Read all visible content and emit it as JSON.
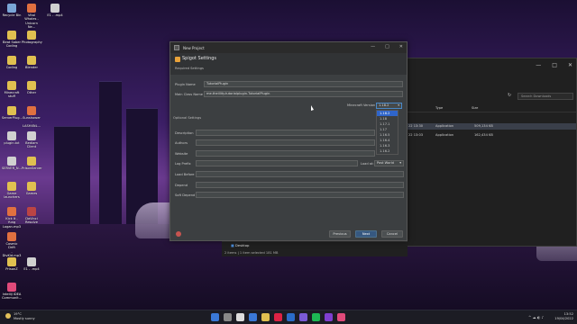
{
  "desktop": {
    "icons": [
      {
        "label": "Recycle Bin",
        "color": "#7aa6d6"
      },
      {
        "label": "Vital Whales -\nUnicorn Ne...",
        "color": "#e07040"
      },
      {
        "label": "E1 - .mp4",
        "color": "#d0d0d0"
      },
      {
        "label": "Beat Saber\nCoding",
        "color": "#e0c050"
      },
      {
        "label": "Photography",
        "color": "#e0c050"
      },
      {
        "label": "Coding",
        "color": "#e0c050"
      },
      {
        "label": "Blender",
        "color": "#e0c050"
      },
      {
        "label": "Minecraft\nstuff",
        "color": "#e0c050"
      },
      {
        "label": "Other",
        "color": "#e0c050"
      },
      {
        "label": "ServerPlug...",
        "color": "#e0c050"
      },
      {
        "label": "Sunshower -\nLASHXNL...",
        "color": "#e07040"
      },
      {
        "label": "plugin.txt",
        "color": "#d0d0d0"
      },
      {
        "label": "Bedlam\nClient",
        "color": "#d0d0d0"
      },
      {
        "label": "SERVER_N...",
        "color": "#d0d0d0"
      },
      {
        "label": "PrisonServer",
        "color": "#e0c050"
      },
      {
        "label": "Game\nlaunchers",
        "color": "#e0c050"
      },
      {
        "label": "Games",
        "color": "#e0c050"
      },
      {
        "label": "Kick It - Yung\nLogan.mp3",
        "color": "#e07040"
      },
      {
        "label": "DaVinci\nResolve",
        "color": "#b44"
      },
      {
        "label": "Cosmic Drift\n- DivKid.mp3",
        "color": "#e07040"
      },
      {
        "label": "PrisonZ",
        "color": "#e0c050"
      },
      {
        "label": "E1 - .mp4",
        "color": "#d0d0d0"
      },
      {
        "label": "IntelliJ IDEA\nCommunit...",
        "color": "#e04a7a"
      }
    ]
  },
  "explorer": {
    "controls": [
      "—",
      "□",
      "✕"
    ],
    "search_placeholder": "Search Downloads",
    "columns": [
      "Type",
      "Size"
    ],
    "rows": [
      {
        "date": "22 13:30",
        "type": "Application",
        "size": "509,134 KB",
        "selected": true
      },
      {
        "date": "22 13:03",
        "type": "Application",
        "size": "162,434 KB",
        "selected": false
      }
    ]
  },
  "mini_explorer": {
    "location": "Desktop",
    "status": "2 items | 1 item selected 181 MB"
  },
  "dialog": {
    "title": "New Project",
    "header_title": "Spigot Settings",
    "required_label": "Required Settings",
    "plugin_name_label": "Plugin Name",
    "plugin_name_value": "TutorialPlugin",
    "main_class_label": "Main Class Name",
    "main_class_value": "me.theillity.tutorialplugin.TutorialPlugin",
    "mc_version_label": "Minecraft Version",
    "mc_version_value": "1.18.2",
    "mc_versions": [
      "1.18.2",
      "1.18",
      "1.17.1",
      "1.17",
      "1.16.5",
      "1.16.4",
      "1.16.3",
      "1.16.2"
    ],
    "optional_label": "Optional Settings",
    "optional_fields": [
      "Description",
      "Authors",
      "Website",
      "Log Prefix",
      "Load Before",
      "Depend",
      "Soft Depend"
    ],
    "load_at_label": "Load at:",
    "load_at_value": "Post World",
    "buttons": {
      "previous": "Previous",
      "next": "Next",
      "cancel": "Cancel"
    }
  },
  "taskbar": {
    "weather_temp": "19°C",
    "weather_desc": "Mostly sunny",
    "time": "13:52",
    "date": "19/04/2022",
    "icon_colors": [
      "#3a78d6",
      "#888",
      "#ddd",
      "#3a78d6",
      "#e0c050",
      "#d24",
      "#2a6cc8",
      "#7a5ad6",
      "#1db954",
      "#7f3fcf",
      "#e04a7a"
    ]
  }
}
